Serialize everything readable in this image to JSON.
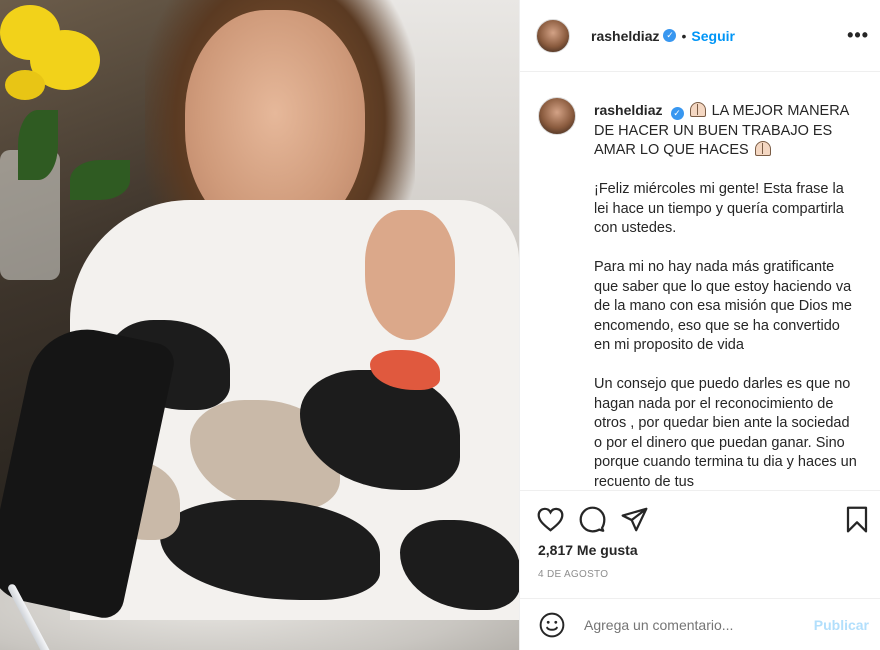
{
  "post": {
    "username": "rasheldiaz",
    "follow_label": "Seguir",
    "separator": "•",
    "more_label": "•••",
    "caption_headline": "LA MEJOR MANERA DE HACER UN BUEN TRABAJO ES AMAR LO QUE HACES",
    "caption_paragraphs": [
      "¡Feliz miércoles mi gente! Esta frase la lei hace un tiempo y quería compartirla con ustedes.",
      "Para mi no hay nada más gratificante que saber que lo que estoy haciendo va de la mano con esa misión que Dios me encomendo, eso que se ha convertido en mi proposito de vida",
      "Un consejo que puedo darles es que no hagan nada por el reconocimiento de otros , por quedar bien ante la sociedad o por el dinero que puedan ganar. Sino porque cuando termina tu dia y haces un recuento de tus"
    ],
    "likes": "2,817 Me gusta",
    "date": "4 DE AGOSTO"
  },
  "comment": {
    "placeholder": "Agrega un comentario...",
    "publish_label": "Publicar"
  },
  "icons": {
    "verified": "verified-badge-icon",
    "like": "heart-icon",
    "comment": "comment-icon",
    "share": "paper-plane-icon",
    "save": "bookmark-icon",
    "emoji": "smiley-icon",
    "caption_emoji": "praying-hands-emoji"
  },
  "colors": {
    "accent": "#0095f6",
    "verified": "#3897f0",
    "publish_disabled": "#b2dffc",
    "muted": "#8e8e8e",
    "text": "#262626"
  }
}
